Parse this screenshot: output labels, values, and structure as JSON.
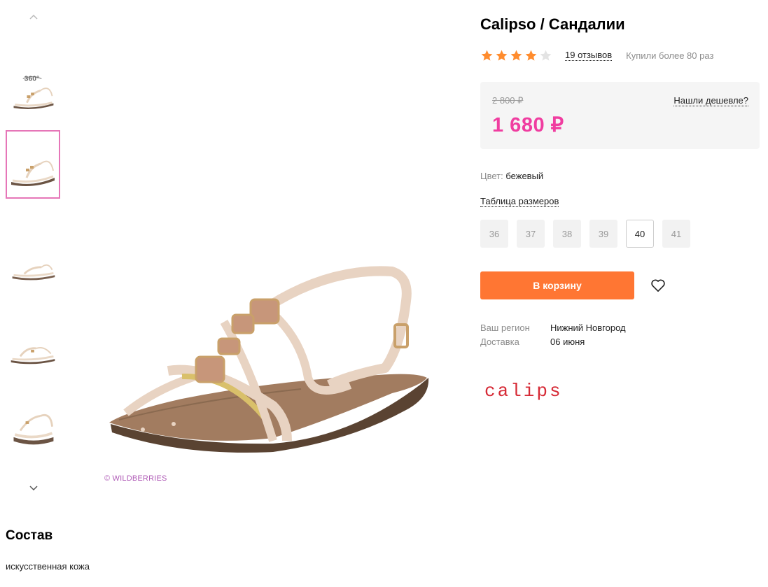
{
  "product": {
    "title": "Calipso / Сандалии",
    "rating": 4,
    "rating_max": 5,
    "reviews": "19 отзывов",
    "bought": "Купили более 80 раз"
  },
  "price": {
    "old": "2 800 ₽",
    "current": "1 680 ₽",
    "cheaper_link": "Нашли дешевле?"
  },
  "color": {
    "label": "Цвет:",
    "value": "бежевый"
  },
  "size_table_link": "Таблица размеров",
  "sizes": [
    "36",
    "37",
    "38",
    "39",
    "40",
    "41"
  ],
  "selected_size": "40",
  "cart_button": "В корзину",
  "delivery": {
    "region_label": "Ваш регион",
    "region_value": "Нижний Новгород",
    "delivery_label": "Доставка",
    "delivery_value": "06 июня"
  },
  "brand_logo": "calipso",
  "watermark": "© WILDBERRIES",
  "thumbnails": {
    "badge_360": "360°",
    "active_index": 1
  },
  "composition": {
    "title": "Состав",
    "text": "искусственная кожа"
  },
  "colors": {
    "accent_orange": "#ff7633",
    "price_pink": "#f03da0",
    "star": "#ff8c2e",
    "brand_red": "#d62a36",
    "thumb_active_border": "#e676b8"
  }
}
